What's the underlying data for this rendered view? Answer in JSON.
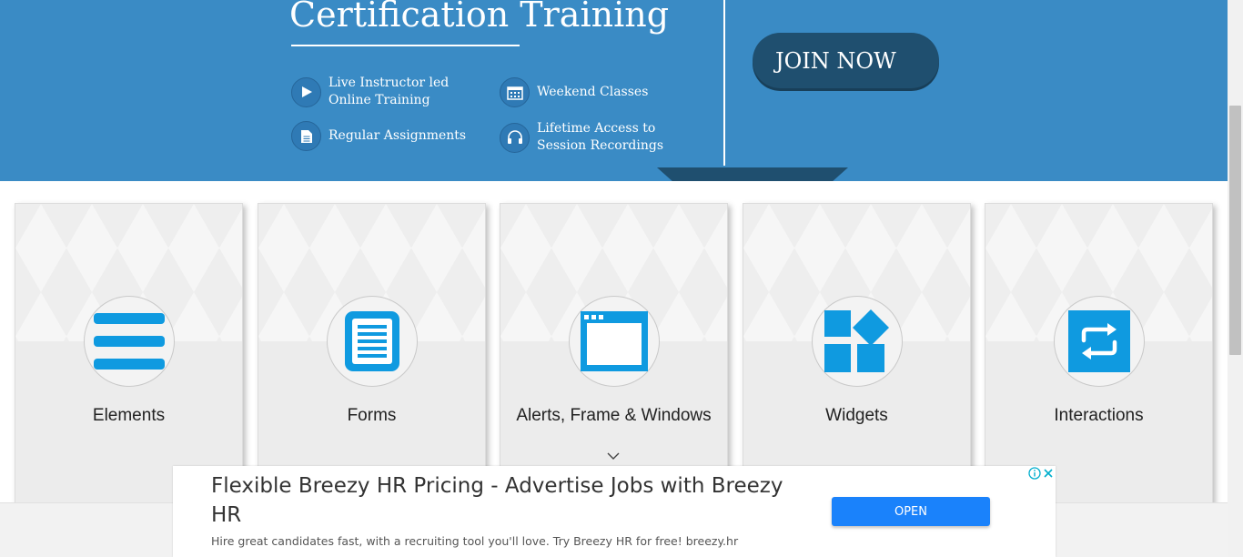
{
  "banner": {
    "title": "Certification Training",
    "features": [
      {
        "text": "Live Instructor led Online Training",
        "icon": "play-icon"
      },
      {
        "text": "Weekend Classes",
        "icon": "calendar-icon"
      },
      {
        "text": "Regular Assignments",
        "icon": "document-icon"
      },
      {
        "text": "Lifetime Access to Session Recordings",
        "icon": "headphones-icon"
      }
    ],
    "join_label": "JOIN NOW"
  },
  "cards": [
    {
      "title": "Elements",
      "icon": "hamburger-icon"
    },
    {
      "title": "Forms",
      "icon": "form-icon"
    },
    {
      "title": "Alerts, Frame & Windows",
      "icon": "browser-window-icon"
    },
    {
      "title": "Widgets",
      "icon": "widgets-icon"
    },
    {
      "title": "Interactions",
      "icon": "repeat-icon"
    }
  ],
  "ad": {
    "headline": "Flexible Breezy HR Pricing - Advertise Jobs with Breezy HR",
    "description": "Hire great candidates fast, with a recruiting tool you'll love. Try Breezy HR for free! breezy.hr",
    "open_label": "OPEN"
  },
  "colors": {
    "banner_blue": "#3a8bc5",
    "dark_navy": "#1f4f6f",
    "icon_blue": "#0f9ae0",
    "ad_button_blue": "#1a82fb"
  }
}
